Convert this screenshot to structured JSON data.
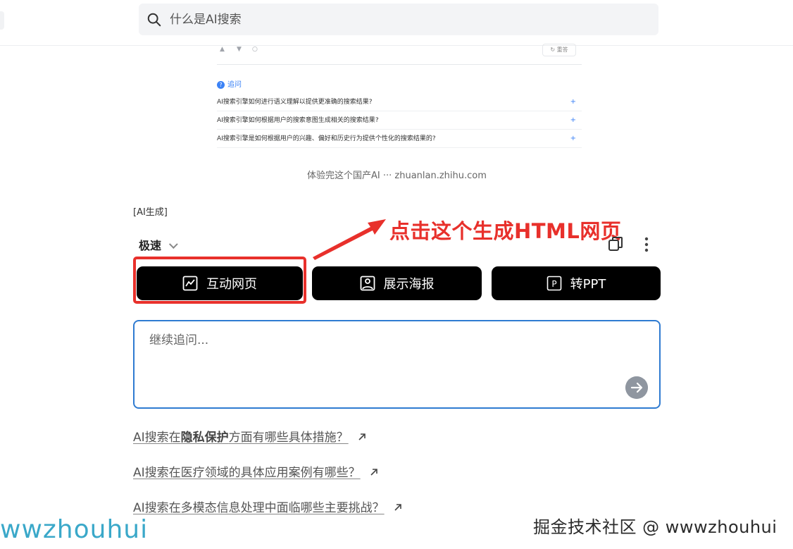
{
  "search": {
    "placeholder": "什么是AI搜索"
  },
  "embedded": {
    "redo_label": "重答",
    "follow_label": "追问",
    "follow_icon": "?",
    "questions": [
      "AI搜索引擎如何进行语义理解以提供更准确的搜索结果?",
      "AI搜索引擎如何根据用户的搜索意图生成相关的搜索结果?",
      "AI搜索引擎是如何根据用户的兴趣、偏好和历史行为提供个性化的搜索结果的?"
    ],
    "plus": "+"
  },
  "caption": "体验完这个国产AI ··· zhuanlan.zhihu.com",
  "ai_tag": "[AI生成]",
  "speed_label": "极速",
  "annotation": "点击这个生成HTML网页",
  "buttons": {
    "web": "互动网页",
    "poster": "展示海报",
    "ppt": "转PPT",
    "ppt_icon_letter": "P"
  },
  "followup": {
    "placeholder": "继续追问..."
  },
  "related": {
    "q1_prefix": "AI搜索在",
    "q1_bold": "隐私保护",
    "q1_suffix": "方面有哪些具体措施？",
    "q2": "AI搜索在医疗领域的具体应用案例有哪些？",
    "q3": "AI搜索在多模态信息处理中面临哪些主要挑战？"
  },
  "watermark_left": "wwzhouhui",
  "watermark_right": "掘金技术社区 @ wwwzhouhui",
  "colors": {
    "annotation_red": "#e8302b",
    "button_bg": "#000000",
    "input_border": "#2f7bd1",
    "watermark_blue": "#3aa8c9"
  }
}
